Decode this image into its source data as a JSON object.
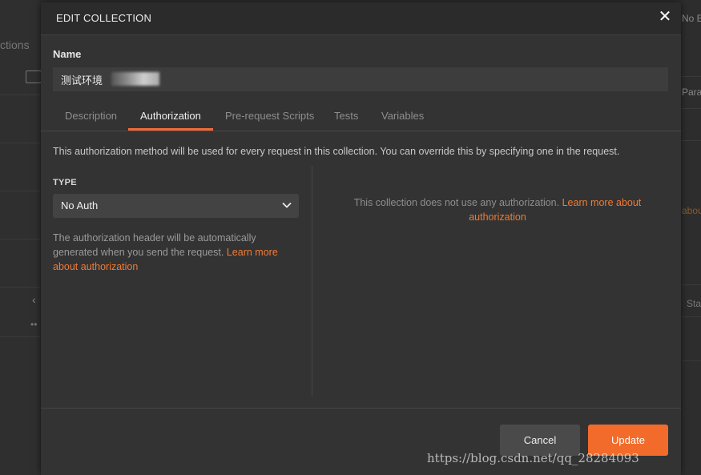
{
  "background": {
    "tab_fragment": "ctions",
    "env_fragment": "No Env",
    "param_fragment": "Params",
    "about_fragment": "about",
    "status_fragment": "Sta"
  },
  "modal": {
    "title": "EDIT COLLECTION",
    "close_glyph": "✕",
    "name_label": "Name",
    "name_value": "测试环境",
    "tabs": [
      "Description",
      "Authorization",
      "Pre-request Scripts",
      "Tests",
      "Variables"
    ],
    "active_tab": "Authorization",
    "info_text": "This authorization method will be used for every request in this collection. You can override this by specifying one in the request.",
    "type_label": "TYPE",
    "type_selected": "No Auth",
    "desc_text": "The authorization header will be automatically generated when you send the request.",
    "desc_link": "Learn more about authorization",
    "noauth_text": "This collection does not use any authorization.",
    "noauth_link": "Learn more about authorization",
    "cancel_label": "Cancel",
    "update_label": "Update"
  },
  "watermark": "https://blog.csdn.net/qq_28284093",
  "colors": {
    "accent": "#f26b2a",
    "link": "#f27a35",
    "modal_bg": "#333333",
    "header_bg": "#2b2b2b"
  },
  "icons": {
    "close": "close-icon",
    "dropdown": "chevron-down-icon"
  }
}
